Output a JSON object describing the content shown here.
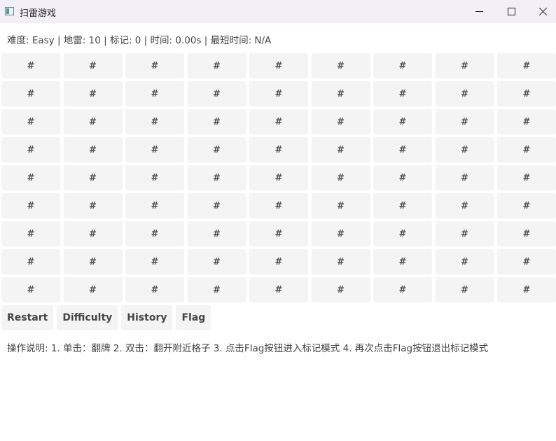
{
  "window": {
    "title": "扫雷游戏",
    "icon": "app-window-icon"
  },
  "status": {
    "text": "难度: Easy | 地雷: 10 | 标记: 0 | 时间: 0.00s | 最短时间: N/A",
    "difficulty": "Easy",
    "mines": 10,
    "flags": 0,
    "time": "0.00s",
    "best_time": "N/A"
  },
  "board": {
    "rows": 9,
    "cols": 9,
    "cells": [
      [
        "#",
        "#",
        "#",
        "#",
        "#",
        "#",
        "#",
        "#",
        "#"
      ],
      [
        "#",
        "#",
        "#",
        "#",
        "#",
        "#",
        "#",
        "#",
        "#"
      ],
      [
        "#",
        "#",
        "#",
        "#",
        "#",
        "#",
        "#",
        "#",
        "#"
      ],
      [
        "#",
        "#",
        "#",
        "#",
        "#",
        "#",
        "#",
        "#",
        "#"
      ],
      [
        "#",
        "#",
        "#",
        "#",
        "#",
        "#",
        "#",
        "#",
        "#"
      ],
      [
        "#",
        "#",
        "#",
        "#",
        "#",
        "#",
        "#",
        "#",
        "#"
      ],
      [
        "#",
        "#",
        "#",
        "#",
        "#",
        "#",
        "#",
        "#",
        "#"
      ],
      [
        "#",
        "#",
        "#",
        "#",
        "#",
        "#",
        "#",
        "#",
        "#"
      ],
      [
        "#",
        "#",
        "#",
        "#",
        "#",
        "#",
        "#",
        "#",
        "#"
      ]
    ]
  },
  "controls": {
    "restart": "Restart",
    "difficulty": "Difficulty",
    "history": "History",
    "flag": "Flag"
  },
  "instructions": "操作说明: 1. 单击：翻牌 2. 双击：翻开附近格子 3. 点击Flag按钮进入标记模式 4. 再次点击Flag按钮退出标记模式"
}
